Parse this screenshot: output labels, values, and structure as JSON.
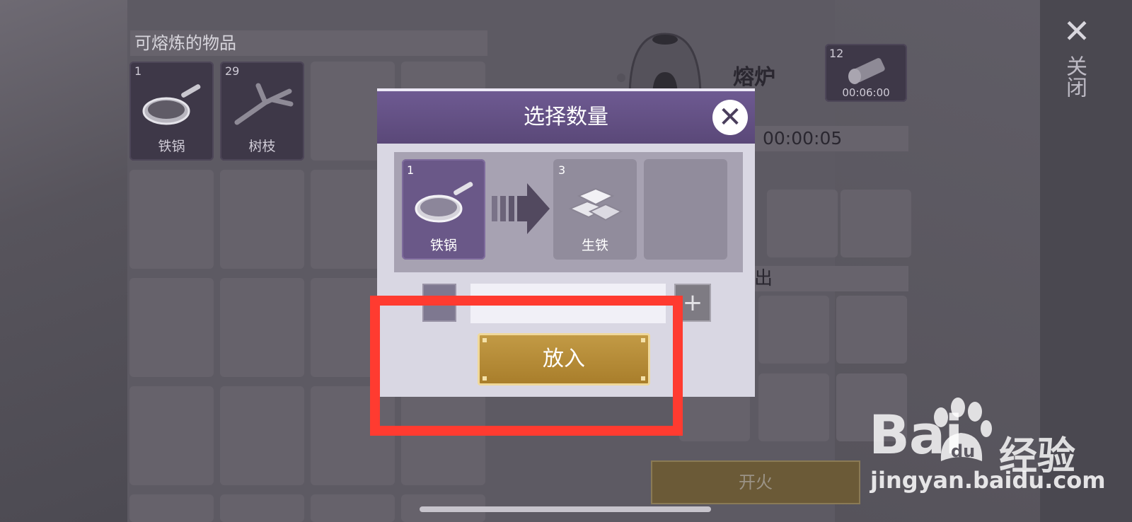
{
  "window": {
    "close_label": "关闭"
  },
  "inventory": {
    "title": "可熔炼的物品",
    "items": [
      {
        "count": "1",
        "name": "铁锅",
        "icon": "frying-pan-icon"
      },
      {
        "count": "29",
        "name": "树枝",
        "icon": "branch-icon"
      }
    ]
  },
  "furnace": {
    "title": "熔炉",
    "fuel": {
      "count": "12",
      "time": "00:06:00",
      "icon": "log-icon"
    },
    "timer": "00:00:05",
    "output_label": "出",
    "fire_button": "开火"
  },
  "dialog": {
    "title": "选择数量",
    "input_item": {
      "count": "1",
      "name": "铁锅",
      "icon": "frying-pan-icon"
    },
    "output_item": {
      "count": "3",
      "name": "生铁",
      "icon": "iron-ingot-icon"
    },
    "quantity_value": "",
    "plus_label": "+",
    "put_button": "放入"
  },
  "watermark": {
    "brand": "Bai",
    "brand2": "du",
    "cn": "经验",
    "url": "jingyan.baidu.com"
  }
}
